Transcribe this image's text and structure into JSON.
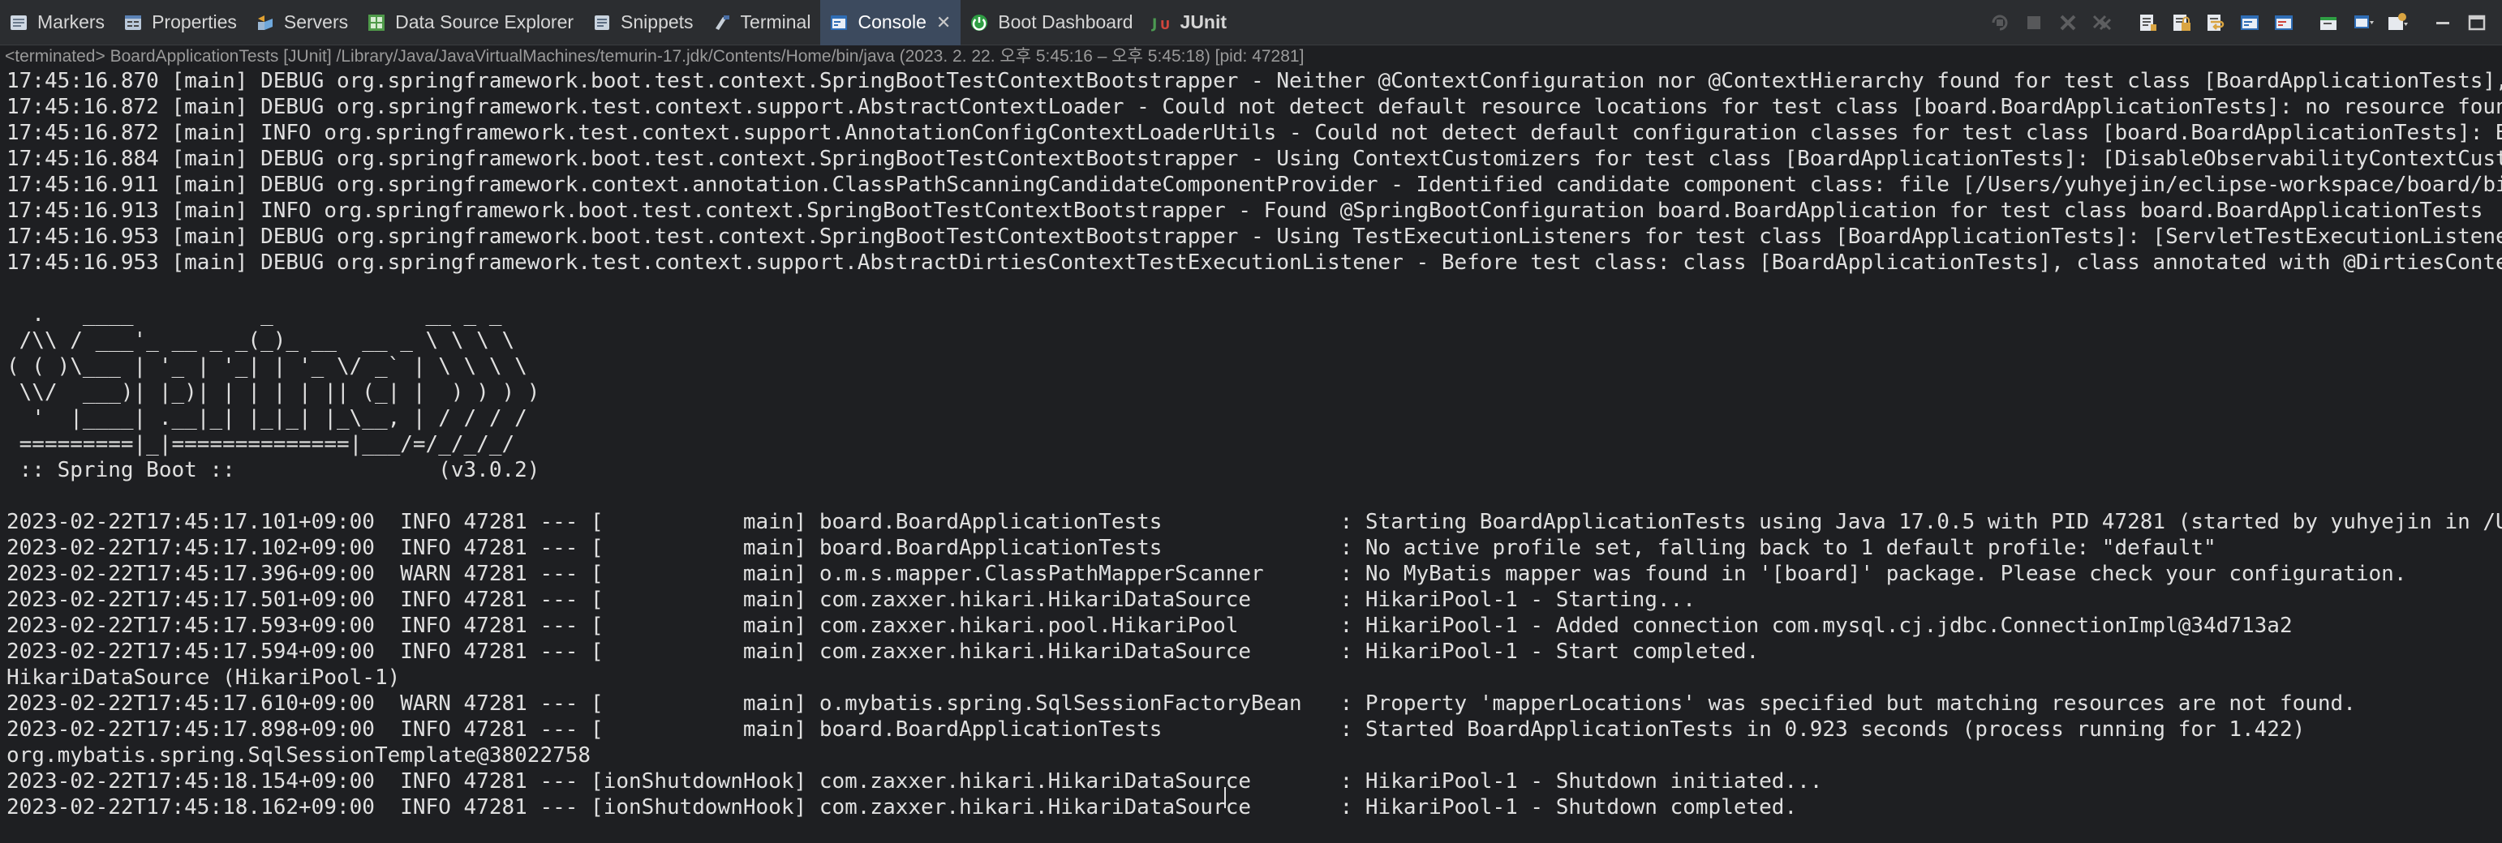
{
  "tabs": [
    {
      "label": "Markers",
      "icon": "markers-icon"
    },
    {
      "label": "Properties",
      "icon": "properties-icon"
    },
    {
      "label": "Servers",
      "icon": "servers-icon"
    },
    {
      "label": "Data Source Explorer",
      "icon": "data-source-explorer-icon"
    },
    {
      "label": "Snippets",
      "icon": "snippets-icon"
    },
    {
      "label": "Terminal",
      "icon": "terminal-icon"
    },
    {
      "label": "Console",
      "icon": "console-icon",
      "active": true,
      "close": "✕"
    },
    {
      "label": "Boot Dashboard",
      "icon": "boot-dashboard-icon"
    },
    {
      "label": "JUnit",
      "icon": "junit-icon",
      "bold": true
    }
  ],
  "toolbar_icons": [
    "terminate-relaunch-icon",
    "terminate-icon",
    "remove-launch-icon",
    "remove-all-terminated-icon",
    "clear-console-icon",
    "scroll-lock-icon",
    "word-wrap-icon",
    "show-on-stdout-icon",
    "show-on-stderr-icon",
    "pin-console-icon",
    "display-selected-console-icon",
    "open-console-icon",
    "minimize-icon",
    "maximize-icon"
  ],
  "status_line": "<terminated> BoardApplicationTests [JUnit] /Library/Java/JavaVirtualMachines/temurin-17.jdk/Contents/Home/bin/java  (2023. 2. 22. 오후 5:45:16 – 오후 5:45:18) [pid: 47281]",
  "console_lines": [
    "17:45:16.870 [main] DEBUG org.springframework.boot.test.context.SpringBootTestContextBootstrapper - Neither @ContextConfiguration nor @ContextHierarchy found for test class [BoardApplicationTests], using SpringBootContextLoader",
    "17:45:16.872 [main] DEBUG org.springframework.test.context.support.AbstractContextLoader - Could not detect default resource locations for test class [board.BoardApplicationTests]: no resource found for suffixes {-context.xml, Context.groovy}.",
    "17:45:16.872 [main] INFO org.springframework.test.context.support.AnnotationConfigContextLoaderUtils - Could not detect default configuration classes for test class [board.BoardApplicationTests]: BoardApplicationTests does not declare any static, non-private, non-final, nested classes annotated with @Configuration.",
    "17:45:16.884 [main] DEBUG org.springframework.boot.test.context.SpringBootTestContextBootstrapper - Using ContextCustomizers for test class [BoardApplicationTests]: [DisableObservabilityContextCustomizer, PropertyMappingContextCustomizer]",
    "17:45:16.911 [main] DEBUG org.springframework.context.annotation.ClassPathScanningCandidateComponentProvider - Identified candidate component class: file [/Users/yuhyejin/eclipse-workspace/board/bin/main/board/BoardApplication.class]",
    "17:45:16.913 [main] INFO org.springframework.boot.test.context.SpringBootTestContextBootstrapper - Found @SpringBootConfiguration board.BoardApplication for test class board.BoardApplicationTests",
    "17:45:16.953 [main] DEBUG org.springframework.boot.test.context.SpringBootTestContextBootstrapper - Using TestExecutionListeners for test class [BoardApplicationTests]: [ServletTestExecutionListener, DirtiesContextBeforeModesTestExecutionListener]",
    "17:45:16.953 [main] DEBUG org.springframework.test.context.support.AbstractDirtiesContextTestExecutionListener - Before test class: class [BoardApplicationTests], class annotated with @DirtiesContext [false] with mode [null]",
    "",
    "  .   ____          _            __ _ _",
    " /\\\\ / ___'_ __ _ _(_)_ __  __ _ \\ \\ \\ \\",
    "( ( )\\___ | '_ | '_| | '_ \\/ _` | \\ \\ \\ \\",
    " \\\\/  ___)| |_)| | | | | || (_| |  ) ) ) )",
    "  '  |____| .__|_| |_|_| |_\\__, | / / / /",
    " =========|_|==============|___/=/_/_/_/",
    " :: Spring Boot ::                (v3.0.2)",
    "",
    "2023-02-22T17:45:17.101+09:00  INFO 47281 --- [           main] board.BoardApplicationTests              : Starting BoardApplicationTests using Java 17.0.5 with PID 47281 (started by yuhyejin in /Users/yuhyejin/eclipse-workspace/board)",
    "2023-02-22T17:45:17.102+09:00  INFO 47281 --- [           main] board.BoardApplicationTests              : No active profile set, falling back to 1 default profile: \"default\"",
    "2023-02-22T17:45:17.396+09:00  WARN 47281 --- [           main] o.m.s.mapper.ClassPathMapperScanner      : No MyBatis mapper was found in '[board]' package. Please check your configuration.",
    "2023-02-22T17:45:17.501+09:00  INFO 47281 --- [           main] com.zaxxer.hikari.HikariDataSource       : HikariPool-1 - Starting...",
    "2023-02-22T17:45:17.593+09:00  INFO 47281 --- [           main] com.zaxxer.hikari.pool.HikariPool        : HikariPool-1 - Added connection com.mysql.cj.jdbc.ConnectionImpl@34d713a2",
    "2023-02-22T17:45:17.594+09:00  INFO 47281 --- [           main] com.zaxxer.hikari.HikariDataSource       : HikariPool-1 - Start completed.",
    "HikariDataSource (HikariPool-1)",
    "2023-02-22T17:45:17.610+09:00  WARN 47281 --- [           main] o.mybatis.spring.SqlSessionFactoryBean   : Property 'mapperLocations' was specified but matching resources are not found.",
    "2023-02-22T17:45:17.898+09:00  INFO 47281 --- [           main] board.BoardApplicationTests              : Started BoardApplicationTests in 0.923 seconds (process running for 1.422)",
    "org.mybatis.spring.SqlSessionTemplate@38022758",
    "2023-02-22T17:45:18.154+09:00  INFO 47281 --- [ionShutdownHook] com.zaxxer.hikari.HikariDataSource       : HikariPool-1 - Shutdown initiated...",
    "2023-02-22T17:45:18.162+09:00  INFO 47281 --- [ionShutdownHook] com.zaxxer.hikari.HikariDataSource       : HikariPool-1 - Shutdown completed."
  ]
}
